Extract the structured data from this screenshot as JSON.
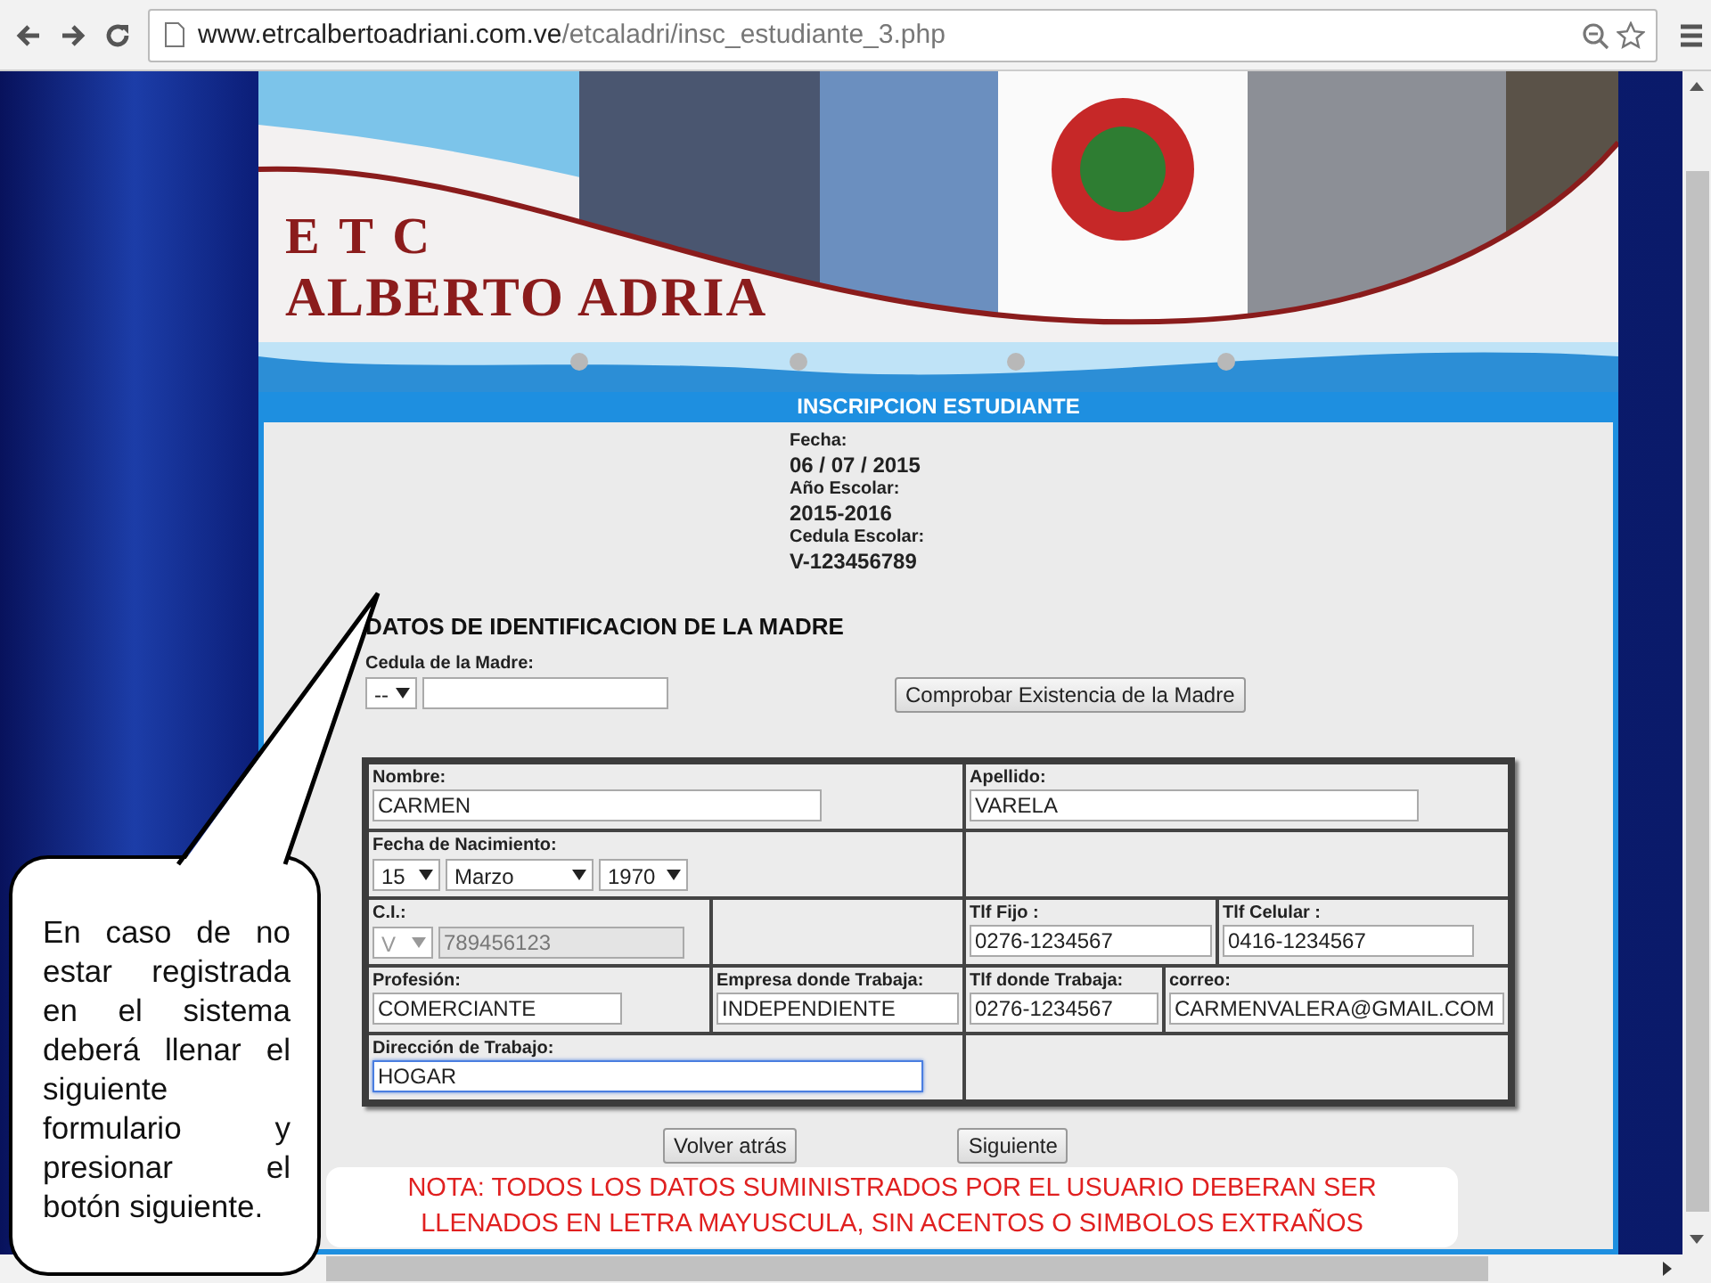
{
  "browser": {
    "url_host": "www.etrcalbertoadriani.com.ve",
    "url_path": "/etcaladri/insc_estudiante_3.php"
  },
  "banner": {
    "line_1": "E T C",
    "line_2": "ALBERTO ADRIA"
  },
  "panel": {
    "title": "INSCRIPCION ESTUDIANTE",
    "info": [
      {
        "label": "Fecha:",
        "value": "06 / 07 / 2015"
      },
      {
        "label": "Año Escolar:",
        "value": "2015-2016"
      },
      {
        "label": "Cedula Escolar:",
        "value": "V-123456789"
      }
    ],
    "section_title": "DATOS DE IDENTIFICACION DE LA MADRE",
    "mother_id": {
      "label": "Cedula de la Madre:",
      "prefix": "--"
    },
    "check_button": "Comprobar Existencia de la Madre",
    "rows": [
      {
        "cells": [
          {
            "kind": "text",
            "colspan": 2,
            "label": "Nombre:",
            "value": "CARMEN",
            "disabled": false,
            "focused": false
          },
          {
            "kind": "text",
            "colspan": 3,
            "label": "Apellido:",
            "value": "VARELA",
            "disabled": false,
            "focused": false
          }
        ]
      },
      {
        "cells": [
          {
            "kind": "date",
            "colspan": 2,
            "label": "Fecha de Nacimiento:",
            "day": "15",
            "month": "Marzo",
            "year": "1970"
          },
          {
            "kind": "empty",
            "colspan": 3
          }
        ]
      },
      {
        "cells": [
          {
            "kind": "id",
            "label": "C.I.:",
            "prefix": "V",
            "value": "789456123",
            "disabled": true,
            "focused": false
          },
          {
            "kind": "empty"
          },
          {
            "kind": "text",
            "colspan": 2,
            "label": "Tlf Fijo :",
            "value": "0276-1234567",
            "disabled": false,
            "focused": false
          },
          {
            "kind": "text",
            "label": "Tlf Celular :",
            "value": "0416-1234567",
            "disabled": false,
            "focused": false
          }
        ]
      },
      {
        "cells": [
          {
            "kind": "text",
            "label": "Profesión:",
            "value": "COMERCIANTE",
            "disabled": false,
            "focused": false
          },
          {
            "kind": "text",
            "label": "Empresa donde Trabaja:",
            "value": "INDEPENDIENTE",
            "disabled": false,
            "focused": false
          },
          {
            "kind": "text",
            "label": "Tlf donde Trabaja:",
            "value": "0276-1234567",
            "disabled": false,
            "focused": false
          },
          {
            "kind": "text",
            "colspan": 2,
            "label": "correo:",
            "value": "CARMENVALERA@GMAIL.COM",
            "disabled": false,
            "focused": false
          }
        ]
      },
      {
        "cells": [
          {
            "kind": "text",
            "colspan": 2,
            "label": "Dirección de Trabajo:",
            "value": "HOGAR",
            "disabled": false,
            "focused": true
          },
          {
            "kind": "empty",
            "colspan": 3
          }
        ]
      }
    ],
    "buttons": [
      "Volver atrás",
      "Siguiente"
    ]
  },
  "callout": "En caso de no estar registrada en el sistema deberá llenar el siguiente formulario y presionar el botón siguiente.",
  "note_lines": [
    "NOTA: TODOS LOS DATOS SUMINISTRADOS POR EL USUARIO DEBERAN SER",
    "LLENADOS EN LETRA MAYUSCULA, SIN ACENTOS O SIMBOLOS EXTRAÑOS"
  ]
}
